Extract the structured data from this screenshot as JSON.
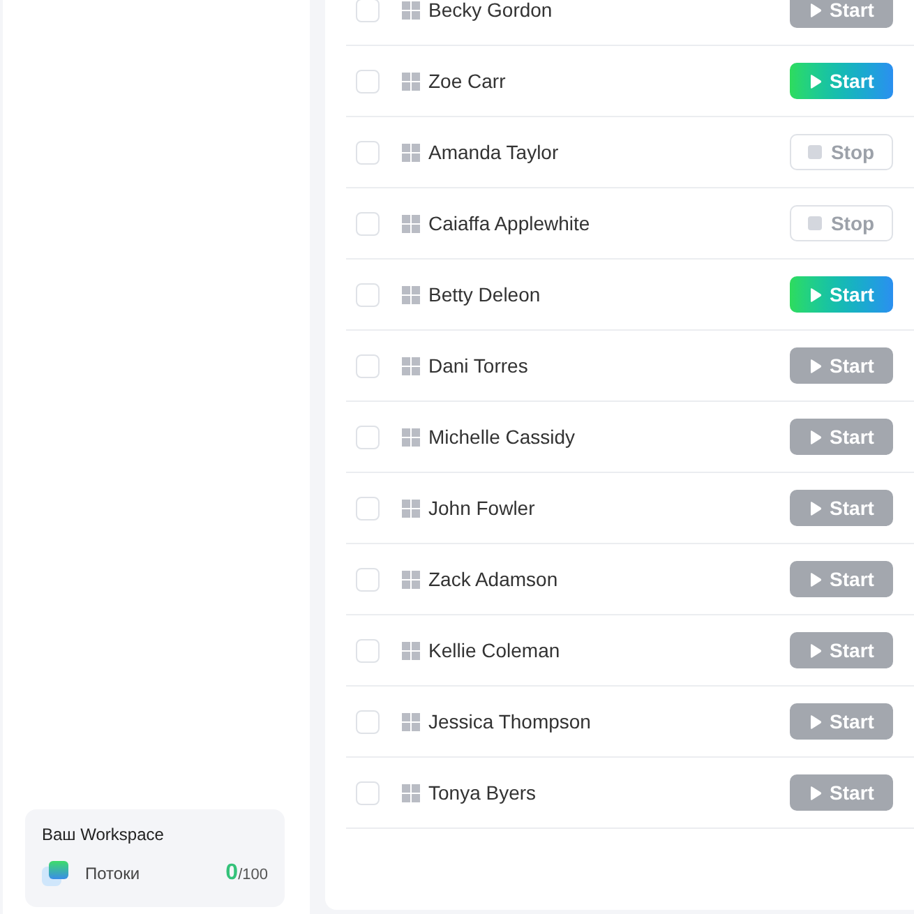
{
  "rows": [
    {
      "name": "Becky Gordon",
      "checked": false,
      "button": {
        "label": "Start",
        "kind": "start",
        "disabled": true
      }
    },
    {
      "name": "Zoe Carr",
      "checked": false,
      "button": {
        "label": "Start",
        "kind": "start",
        "disabled": false
      }
    },
    {
      "name": "Amanda Taylor",
      "checked": false,
      "button": {
        "label": "Stop",
        "kind": "stop",
        "disabled": true
      }
    },
    {
      "name": "Caiaffa Applewhite",
      "checked": false,
      "button": {
        "label": "Stop",
        "kind": "stop",
        "disabled": true
      }
    },
    {
      "name": "Betty Deleon",
      "checked": false,
      "button": {
        "label": "Start",
        "kind": "start",
        "disabled": false
      }
    },
    {
      "name": "Dani Torres",
      "checked": false,
      "button": {
        "label": "Start",
        "kind": "start",
        "disabled": true
      }
    },
    {
      "name": "Michelle Cassidy",
      "checked": false,
      "button": {
        "label": "Start",
        "kind": "start",
        "disabled": true
      }
    },
    {
      "name": "John Fowler",
      "checked": false,
      "button": {
        "label": "Start",
        "kind": "start",
        "disabled": true
      }
    },
    {
      "name": "Zack Adamson",
      "checked": false,
      "button": {
        "label": "Start",
        "kind": "start",
        "disabled": true
      }
    },
    {
      "name": "Kellie Coleman",
      "checked": false,
      "button": {
        "label": "Start",
        "kind": "start",
        "disabled": true
      }
    },
    {
      "name": "Jessica Thompson",
      "checked": false,
      "button": {
        "label": "Start",
        "kind": "start",
        "disabled": true
      }
    },
    {
      "name": "Tonya Byers",
      "checked": false,
      "button": {
        "label": "Start",
        "kind": "start",
        "disabled": true
      }
    }
  ],
  "workspace": {
    "title": "Ваш Workspace",
    "label": "Потоки",
    "count": "0",
    "limit": "/100"
  }
}
